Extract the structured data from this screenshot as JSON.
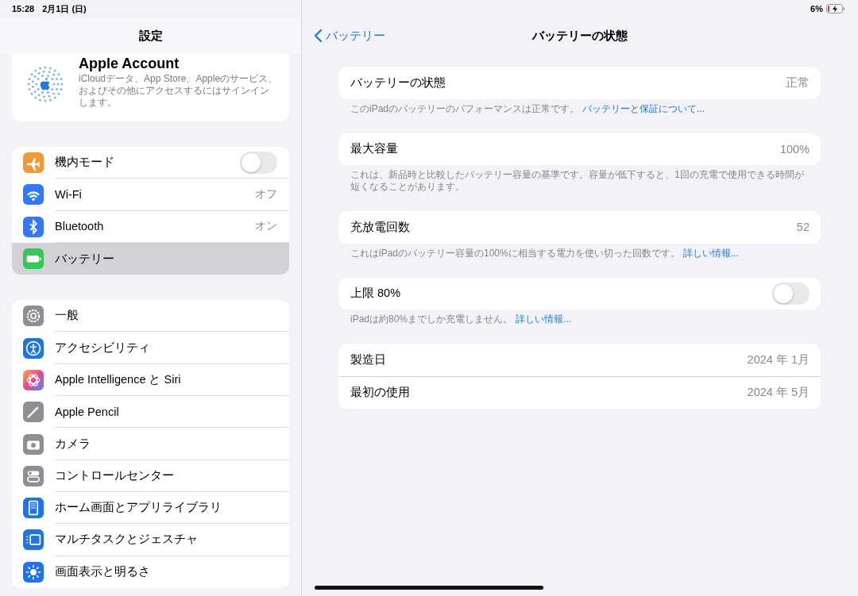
{
  "status_bar": {
    "time": "15:28",
    "date": "2月1日 (日)",
    "battery_percent": "6%"
  },
  "sidebar": {
    "title": "設定",
    "account": {
      "name": "Apple Account",
      "description": "iCloudデータ、App Store、Appleのサービス、およびその他にアクセスするにはサインインします。"
    },
    "groups": [
      [
        {
          "label": "機内モード",
          "kind": "toggle",
          "on": false,
          "selected": false
        },
        {
          "label": "Wi-Fi",
          "kind": "value",
          "value": "オフ",
          "selected": false
        },
        {
          "label": "Bluetooth",
          "kind": "value",
          "value": "オン",
          "selected": false
        },
        {
          "label": "バッテリー",
          "kind": "plain",
          "selected": true
        }
      ],
      [
        {
          "label": "一般",
          "kind": "plain",
          "selected": false
        },
        {
          "label": "アクセシビリティ",
          "kind": "plain",
          "selected": false
        },
        {
          "label": "Apple Intelligence と Siri",
          "kind": "plain",
          "selected": false
        },
        {
          "label": "Apple Pencil",
          "kind": "plain",
          "selected": false
        },
        {
          "label": "カメラ",
          "kind": "plain",
          "selected": false
        },
        {
          "label": "コントロールセンター",
          "kind": "plain",
          "selected": false
        },
        {
          "label": "ホーム画面とアプリライブラリ",
          "kind": "plain",
          "selected": false
        },
        {
          "label": "マルチタスクとジェスチャ",
          "kind": "plain",
          "selected": false
        },
        {
          "label": "画面表示と明るさ",
          "kind": "plain",
          "selected": false
        }
      ]
    ]
  },
  "detail": {
    "back": "バッテリー",
    "title": "バッテリーの状態",
    "sections": [
      {
        "rows": [
          {
            "label": "バッテリーの状態",
            "kind": "value",
            "value": "正常"
          }
        ],
        "footer": "このiPadのバッテリーのパフォーマンスは正常です。",
        "footer_link": "バッテリーと保証について..."
      },
      {
        "rows": [
          {
            "label": "最大容量",
            "kind": "value",
            "value": "100%"
          }
        ],
        "footer": "これは、新品時と比較したバッテリー容量の基準です。容量が低下すると、1回の充電で使用できる時間が短くなることがあります。"
      },
      {
        "rows": [
          {
            "label": "充放電回数",
            "kind": "value",
            "value": "52"
          }
        ],
        "footer": "これはiPadのバッテリー容量の100%に相当する電力を使い切った回数です。",
        "footer_link": "詳しい情報..."
      },
      {
        "rows": [
          {
            "label": "上限 80%",
            "kind": "toggle",
            "on": false
          }
        ],
        "footer": "iPadは約80%までしか充電しません。",
        "footer_link": "詳しい情報..."
      },
      {
        "rows": [
          {
            "label": "製造日",
            "kind": "value",
            "value": "2024 年 1月"
          },
          {
            "label": "最初の使用",
            "kind": "value",
            "value": "2024 年 5月"
          }
        ]
      }
    ]
  }
}
